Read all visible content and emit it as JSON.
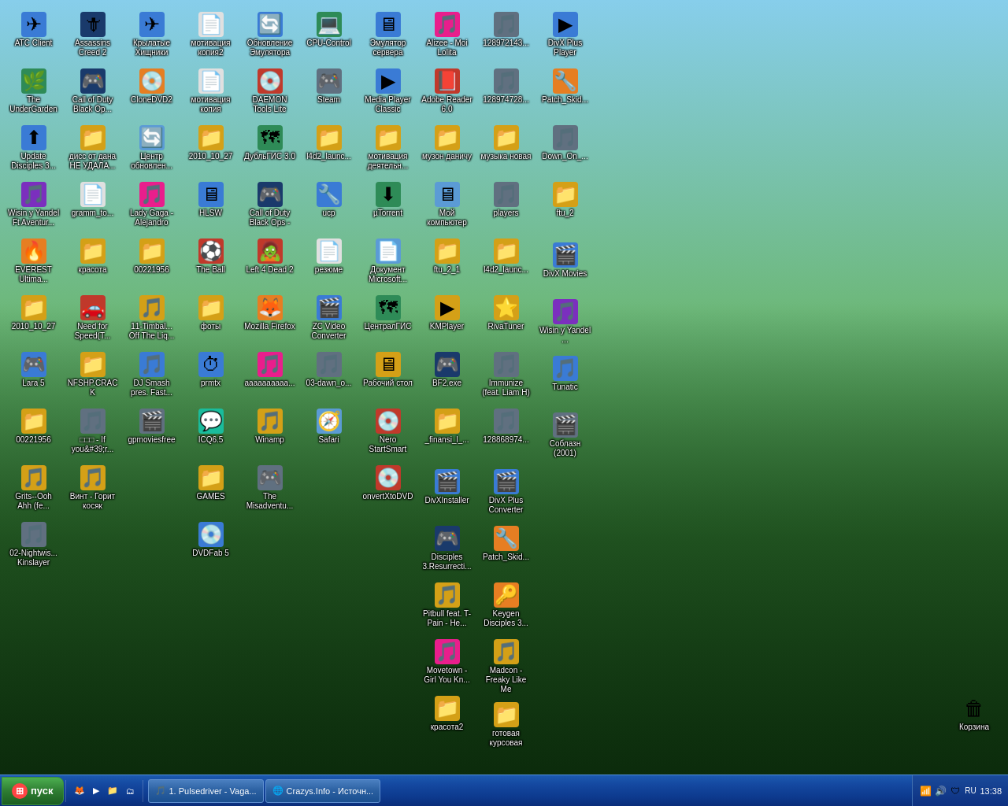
{
  "desktop": {
    "title": "Desktop",
    "background": "green grass with sky"
  },
  "icons": [
    {
      "id": 1,
      "label": "ATC Client",
      "color": "ic-blue",
      "emoji": "✈",
      "col": 1
    },
    {
      "id": 2,
      "label": "The UnderGarden",
      "color": "ic-green",
      "emoji": "🌿",
      "col": 1
    },
    {
      "id": 3,
      "label": "Update Disciples 3...",
      "color": "ic-blue",
      "emoji": "⬆",
      "col": 1
    },
    {
      "id": 4,
      "label": "Wisin y Yandel Ft Aventur...",
      "color": "ic-purple",
      "emoji": "🎵",
      "col": 1
    },
    {
      "id": 5,
      "label": "EVEREST Ultima...",
      "color": "ic-orange",
      "emoji": "🔥",
      "col": 1
    },
    {
      "id": 6,
      "label": "2010_10_27",
      "color": "ic-folder",
      "emoji": "📁",
      "col": 1
    },
    {
      "id": 7,
      "label": "Lara 5",
      "color": "ic-blue",
      "emoji": "🎮",
      "col": 1
    },
    {
      "id": 8,
      "label": "00221956",
      "color": "ic-folder",
      "emoji": "📁",
      "col": 1
    },
    {
      "id": 9,
      "label": "Grits--Ooh Ahh (fe...",
      "color": "ic-yellow",
      "emoji": "🎵",
      "col": 1
    },
    {
      "id": 10,
      "label": "02-Nightwis... Kinslayer",
      "color": "ic-gray",
      "emoji": "🎵",
      "col": 1
    },
    {
      "id": 11,
      "label": "Assassins Creed 2",
      "color": "ic-darkblue",
      "emoji": "🗡",
      "col": 2
    },
    {
      "id": 12,
      "label": "Call of Duty Black Op...",
      "color": "ic-darkblue",
      "emoji": "🎮",
      "col": 2
    },
    {
      "id": 13,
      "label": "дисс от дана НЕ УДАЛА...",
      "color": "ic-folder",
      "emoji": "📁",
      "col": 2
    },
    {
      "id": 14,
      "label": "gramm_to...",
      "color": "ic-white",
      "emoji": "📄",
      "col": 2
    },
    {
      "id": 15,
      "label": "красота",
      "color": "ic-folder",
      "emoji": "📁",
      "col": 2
    },
    {
      "id": 16,
      "label": "Need for Speed(T...",
      "color": "ic-red",
      "emoji": "🚗",
      "col": 2
    },
    {
      "id": 17,
      "label": "NFSHP.CRACK",
      "color": "ic-folder",
      "emoji": "📁",
      "col": 2
    },
    {
      "id": 18,
      "label": "□□□ - If you&#39;r...",
      "color": "ic-gray",
      "emoji": "🎵",
      "col": 2
    },
    {
      "id": 19,
      "label": "Винт - Горит косяк",
      "color": "ic-yellow",
      "emoji": "🎵",
      "col": 2
    },
    {
      "id": 20,
      "label": "Крылатые Хищники",
      "color": "ic-blue",
      "emoji": "✈",
      "col": 3
    },
    {
      "id": 21,
      "label": "CloneDVD2",
      "color": "ic-orange",
      "emoji": "💿",
      "col": 3
    },
    {
      "id": 22,
      "label": "Центр обновлен...",
      "color": "ic-lightblue",
      "emoji": "🔄",
      "col": 3
    },
    {
      "id": 23,
      "label": "Lady Gaga - Alejandro",
      "color": "ic-pink",
      "emoji": "🎵",
      "col": 3
    },
    {
      "id": 24,
      "label": "00221956",
      "color": "ic-folder",
      "emoji": "📁",
      "col": 3
    },
    {
      "id": 25,
      "label": "11-Timbal... Off The Liq...",
      "color": "ic-yellow",
      "emoji": "🎵",
      "col": 3
    },
    {
      "id": 26,
      "label": "DJ Smash pres. Fast...",
      "color": "ic-blue",
      "emoji": "🎵",
      "col": 3
    },
    {
      "id": 27,
      "label": "gpmoviesfree",
      "color": "ic-gray",
      "emoji": "🎬",
      "col": 3
    },
    {
      "id": 28,
      "label": "мотивация копия2",
      "color": "ic-white",
      "emoji": "📄",
      "col": 4
    },
    {
      "id": 29,
      "label": "мотивация копия",
      "color": "ic-white",
      "emoji": "📄",
      "col": 4
    },
    {
      "id": 30,
      "label": "2010_10_27",
      "color": "ic-folder",
      "emoji": "📁",
      "col": 4
    },
    {
      "id": 31,
      "label": "HLSW",
      "color": "ic-blue",
      "emoji": "🖥",
      "col": 4
    },
    {
      "id": 32,
      "label": "The Ball",
      "color": "ic-red",
      "emoji": "⚽",
      "col": 4
    },
    {
      "id": 33,
      "label": "фоты",
      "color": "ic-folder",
      "emoji": "📁",
      "col": 4
    },
    {
      "id": 34,
      "label": "prmtx",
      "color": "ic-blue",
      "emoji": "⏱",
      "col": 4
    },
    {
      "id": 35,
      "label": "ICQ6.5",
      "color": "ic-teal",
      "emoji": "💬",
      "col": 4
    },
    {
      "id": 36,
      "label": "GAMES",
      "color": "ic-folder",
      "emoji": "📁",
      "col": 4
    },
    {
      "id": 37,
      "label": "DVDFab 5",
      "color": "ic-blue",
      "emoji": "💿",
      "col": 4
    },
    {
      "id": 38,
      "label": "Обновление Эмулятора",
      "color": "ic-blue",
      "emoji": "🔄",
      "col": 5
    },
    {
      "id": 39,
      "label": "DAEMON Tools Lite",
      "color": "ic-red",
      "emoji": "💿",
      "col": 5
    },
    {
      "id": 40,
      "label": "ДубльГИС 3.0",
      "color": "ic-green",
      "emoji": "🗺",
      "col": 5
    },
    {
      "id": 41,
      "label": "Call of Duty Black Ops -",
      "color": "ic-darkblue",
      "emoji": "🎮",
      "col": 5
    },
    {
      "id": 42,
      "label": "Left 4 Dead 2",
      "color": "ic-red",
      "emoji": "🧟",
      "col": 5
    },
    {
      "id": 43,
      "label": "Mozilla Firefox",
      "color": "ic-orange",
      "emoji": "🦊",
      "col": 5
    },
    {
      "id": 44,
      "label": "аааааааааа...",
      "color": "ic-pink",
      "emoji": "🎵",
      "col": 5
    },
    {
      "id": 45,
      "label": "Winamp",
      "color": "ic-yellow",
      "emoji": "🎵",
      "col": 5
    },
    {
      "id": 46,
      "label": "The Misadventu...",
      "color": "ic-gray",
      "emoji": "🎮",
      "col": 5
    },
    {
      "id": 47,
      "label": "CPU-Control",
      "color": "ic-green",
      "emoji": "💻",
      "col": 6
    },
    {
      "id": 48,
      "label": "Steam",
      "color": "ic-gray",
      "emoji": "🎮",
      "col": 6
    },
    {
      "id": 49,
      "label": "l4d2_launc...",
      "color": "ic-folder",
      "emoji": "📁",
      "col": 6
    },
    {
      "id": 50,
      "label": "ucp",
      "color": "ic-blue",
      "emoji": "🔧",
      "col": 6
    },
    {
      "id": 51,
      "label": "резюме",
      "color": "ic-white",
      "emoji": "📄",
      "col": 6
    },
    {
      "id": 52,
      "label": "ZC Video Converter",
      "color": "ic-blue",
      "emoji": "🎬",
      "col": 6
    },
    {
      "id": 53,
      "label": "03-dawn_o...",
      "color": "ic-gray",
      "emoji": "🎵",
      "col": 6
    },
    {
      "id": 54,
      "label": "Safari",
      "color": "ic-lightblue",
      "emoji": "🧭",
      "col": 6
    },
    {
      "id": 55,
      "label": "Эмулятор сервера",
      "color": "ic-blue",
      "emoji": "🖥",
      "col": 7
    },
    {
      "id": 56,
      "label": "Media Player Classic",
      "color": "ic-blue",
      "emoji": "▶",
      "col": 7
    },
    {
      "id": 57,
      "label": "мотивация деятельн...",
      "color": "ic-folder",
      "emoji": "📁",
      "col": 7
    },
    {
      "id": 58,
      "label": "µTorrent",
      "color": "ic-green",
      "emoji": "⬇",
      "col": 7
    },
    {
      "id": 59,
      "label": "Документ Microsoft...",
      "color": "ic-lightblue",
      "emoji": "📄",
      "col": 7
    },
    {
      "id": 60,
      "label": "ЦентралГИС",
      "color": "ic-green",
      "emoji": "🗺",
      "col": 7
    },
    {
      "id": 61,
      "label": "Рабочий стол",
      "color": "ic-folder",
      "emoji": "🖥",
      "col": 7
    },
    {
      "id": 62,
      "label": "Nero StartSmart",
      "color": "ic-red",
      "emoji": "💿",
      "col": 7
    },
    {
      "id": 63,
      "label": "onvertXtoDVD",
      "color": "ic-red",
      "emoji": "💿",
      "col": 7
    },
    {
      "id": 64,
      "label": "Alizee - Moi Lolita",
      "color": "ic-pink",
      "emoji": "🎵",
      "col": 8
    },
    {
      "id": 65,
      "label": "Adobe Reader 6.0",
      "color": "ic-red",
      "emoji": "📕",
      "col": 8
    },
    {
      "id": 66,
      "label": "музон даничу",
      "color": "ic-folder",
      "emoji": "📁",
      "col": 8
    },
    {
      "id": 67,
      "label": "Мой компьютер",
      "color": "ic-lightblue",
      "emoji": "🖥",
      "col": 8
    },
    {
      "id": 68,
      "label": "ftu_2_1",
      "color": "ic-folder",
      "emoji": "📁",
      "col": 8
    },
    {
      "id": 69,
      "label": "KMPlayer",
      "color": "ic-yellow",
      "emoji": "▶",
      "col": 8
    },
    {
      "id": 70,
      "label": "BF2.exe",
      "color": "ic-darkblue",
      "emoji": "🎮",
      "col": 8
    },
    {
      "id": 71,
      "label": "_finansi_l_...",
      "color": "ic-folder",
      "emoji": "📁",
      "col": 8
    },
    {
      "id": 72,
      "label": "DivXInstaller",
      "color": "ic-blue",
      "emoji": "🎬",
      "col": 9
    },
    {
      "id": 73,
      "label": "Disciples 3.Resurrecti...",
      "color": "ic-darkblue",
      "emoji": "🎮",
      "col": 9
    },
    {
      "id": 74,
      "label": "Pitbull feat. T-Pain - He...",
      "color": "ic-yellow",
      "emoji": "🎵",
      "col": 9
    },
    {
      "id": 75,
      "label": "Movetown - Girl You Kn...",
      "color": "ic-pink",
      "emoji": "🎵",
      "col": 9
    },
    {
      "id": 76,
      "label": "красота2",
      "color": "ic-folder",
      "emoji": "📁",
      "col": 9
    },
    {
      "id": 77,
      "label": "128972143...",
      "color": "ic-gray",
      "emoji": "🎵",
      "col": 10
    },
    {
      "id": 78,
      "label": "128974728...",
      "color": "ic-gray",
      "emoji": "🎵",
      "col": 10
    },
    {
      "id": 79,
      "label": "музыка новая",
      "color": "ic-folder",
      "emoji": "📁",
      "col": 10
    },
    {
      "id": 80,
      "label": "players",
      "color": "ic-gray",
      "emoji": "🎵",
      "col": 10
    },
    {
      "id": 81,
      "label": "l4d2_launc...",
      "color": "ic-folder",
      "emoji": "📁",
      "col": 10
    },
    {
      "id": 82,
      "label": "RivaTuner",
      "color": "ic-yellow",
      "emoji": "⭐",
      "col": 10
    },
    {
      "id": 83,
      "label": "Immunize (feat. Liam H)",
      "color": "ic-gray",
      "emoji": "🎵",
      "col": 10
    },
    {
      "id": 84,
      "label": "128868974...",
      "color": "ic-gray",
      "emoji": "🎵",
      "col": 10
    },
    {
      "id": 85,
      "label": "DivX Plus Converter",
      "color": "ic-blue",
      "emoji": "🎬",
      "col": 11
    },
    {
      "id": 86,
      "label": "Patch_Skid...",
      "color": "ic-orange",
      "emoji": "🔧",
      "col": 11
    },
    {
      "id": 87,
      "label": "Keygen Disciples 3...",
      "color": "ic-orange",
      "emoji": "🔑",
      "col": 11
    },
    {
      "id": 88,
      "label": "Madcon - Freaky Like Me",
      "color": "ic-yellow",
      "emoji": "🎵",
      "col": 11
    },
    {
      "id": 89,
      "label": "готовая курсовая",
      "color": "ic-folder",
      "emoji": "📁",
      "col": 11
    },
    {
      "id": 90,
      "label": "DivX Plus Player",
      "color": "ic-blue",
      "emoji": "▶",
      "col": 12
    },
    {
      "id": 91,
      "label": "Patch_Skid...",
      "color": "ic-orange",
      "emoji": "🔧",
      "col": 12
    },
    {
      "id": 92,
      "label": "Down_On_...",
      "color": "ic-gray",
      "emoji": "🎵",
      "col": 12
    },
    {
      "id": 93,
      "label": "ftu_2",
      "color": "ic-folder",
      "emoji": "📁",
      "col": 12
    },
    {
      "id": 94,
      "label": "DivX Movies",
      "color": "ic-blue",
      "emoji": "🎬",
      "col": 13
    },
    {
      "id": 95,
      "label": "Wisin y Yandel ...",
      "color": "ic-purple",
      "emoji": "🎵",
      "col": 13
    },
    {
      "id": 96,
      "label": "Tunatic",
      "color": "ic-blue",
      "emoji": "🎵",
      "col": 13
    },
    {
      "id": 97,
      "label": "Соблазн (2001)",
      "color": "ic-gray",
      "emoji": "🎬",
      "col": 13
    }
  ],
  "recycle_bin": {
    "label": "Корзина",
    "emoji": "🗑"
  },
  "taskbar": {
    "start_label": "пуск",
    "quick_launch": [
      {
        "name": "Firefox quick",
        "emoji": "🦊"
      },
      {
        "name": "Media player quick",
        "emoji": "▶"
      },
      {
        "name": "Folder quick",
        "emoji": "📁"
      }
    ],
    "open_items": [
      {
        "label": "1. Pulsedriver - Vaga...",
        "emoji": "🎵"
      },
      {
        "label": "Crazys.Info - Источн...",
        "emoji": "🌐"
      }
    ],
    "tray": [
      {
        "name": "network",
        "emoji": "📶"
      },
      {
        "name": "volume",
        "emoji": "🔊"
      },
      {
        "name": "antivirus",
        "emoji": "🛡"
      },
      {
        "name": "clock-icon",
        "emoji": ""
      }
    ],
    "time": "13:38"
  }
}
